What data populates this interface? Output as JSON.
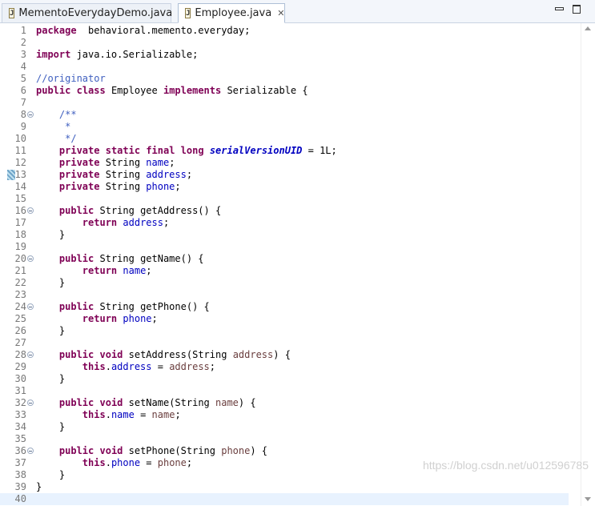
{
  "tabs": [
    {
      "label": "MementoEverydayDemo.java",
      "icon": "java-file-icon",
      "active": false
    },
    {
      "label": "Employee.java",
      "icon": "java-file-icon",
      "active": true,
      "close_glyph": "✕"
    }
  ],
  "window_controls": {
    "minimize": "minimize-icon",
    "maximize": "maximize-icon"
  },
  "editor": {
    "lines": [
      {
        "n": "1",
        "fold": false,
        "parts": [
          [
            "kw",
            "package"
          ],
          [
            "",
            "  behavioral.memento.everyday;"
          ]
        ]
      },
      {
        "n": "2",
        "fold": false,
        "parts": []
      },
      {
        "n": "3",
        "fold": false,
        "parts": [
          [
            "kw",
            "import"
          ],
          [
            "",
            " java.io.Serializable;"
          ]
        ]
      },
      {
        "n": "4",
        "fold": false,
        "parts": []
      },
      {
        "n": "5",
        "fold": false,
        "parts": [
          [
            "cm",
            "//originator"
          ]
        ]
      },
      {
        "n": "6",
        "fold": false,
        "parts": [
          [
            "kw",
            "public"
          ],
          [
            "",
            " "
          ],
          [
            "kw",
            "class"
          ],
          [
            "",
            " Employee "
          ],
          [
            "kw",
            "implements"
          ],
          [
            "",
            " Serializable {"
          ]
        ]
      },
      {
        "n": "7",
        "fold": false,
        "parts": []
      },
      {
        "n": "8",
        "fold": true,
        "parts": [
          [
            "",
            "    "
          ],
          [
            "cm",
            "/**"
          ]
        ]
      },
      {
        "n": "9",
        "fold": false,
        "parts": [
          [
            "",
            "     "
          ],
          [
            "cm",
            "*"
          ]
        ]
      },
      {
        "n": "10",
        "fold": false,
        "parts": [
          [
            "",
            "     "
          ],
          [
            "cm",
            "*/"
          ]
        ]
      },
      {
        "n": "11",
        "fold": false,
        "parts": [
          [
            "",
            "    "
          ],
          [
            "kw",
            "private"
          ],
          [
            "",
            " "
          ],
          [
            "kw",
            "static"
          ],
          [
            "",
            " "
          ],
          [
            "kw",
            "final"
          ],
          [
            "",
            " "
          ],
          [
            "kw",
            "long"
          ],
          [
            "",
            " "
          ],
          [
            "sfld",
            "serialVersionUID"
          ],
          [
            "",
            " = 1L;"
          ]
        ]
      },
      {
        "n": "12",
        "fold": false,
        "parts": [
          [
            "",
            "    "
          ],
          [
            "kw",
            "private"
          ],
          [
            "",
            " String "
          ],
          [
            "fld",
            "name"
          ],
          [
            "",
            ";"
          ]
        ]
      },
      {
        "n": "13",
        "fold": false,
        "marker": true,
        "parts": [
          [
            "",
            "    "
          ],
          [
            "kw",
            "private"
          ],
          [
            "",
            " String "
          ],
          [
            "fld",
            "address"
          ],
          [
            "",
            ";"
          ]
        ]
      },
      {
        "n": "14",
        "fold": false,
        "parts": [
          [
            "",
            "    "
          ],
          [
            "kw",
            "private"
          ],
          [
            "",
            " String "
          ],
          [
            "fld",
            "phone"
          ],
          [
            "",
            ";"
          ]
        ]
      },
      {
        "n": "15",
        "fold": false,
        "parts": []
      },
      {
        "n": "16",
        "fold": true,
        "parts": [
          [
            "",
            "    "
          ],
          [
            "kw",
            "public"
          ],
          [
            "",
            " String getAddress() {"
          ]
        ]
      },
      {
        "n": "17",
        "fold": false,
        "parts": [
          [
            "",
            "        "
          ],
          [
            "kw",
            "return"
          ],
          [
            "",
            " "
          ],
          [
            "fld",
            "address"
          ],
          [
            "",
            ";"
          ]
        ]
      },
      {
        "n": "18",
        "fold": false,
        "parts": [
          [
            "",
            "    }"
          ]
        ]
      },
      {
        "n": "19",
        "fold": false,
        "parts": []
      },
      {
        "n": "20",
        "fold": true,
        "parts": [
          [
            "",
            "    "
          ],
          [
            "kw",
            "public"
          ],
          [
            "",
            " String getName() {"
          ]
        ]
      },
      {
        "n": "21",
        "fold": false,
        "parts": [
          [
            "",
            "        "
          ],
          [
            "kw",
            "return"
          ],
          [
            "",
            " "
          ],
          [
            "fld",
            "name"
          ],
          [
            "",
            ";"
          ]
        ]
      },
      {
        "n": "22",
        "fold": false,
        "parts": [
          [
            "",
            "    }"
          ]
        ]
      },
      {
        "n": "23",
        "fold": false,
        "parts": []
      },
      {
        "n": "24",
        "fold": true,
        "parts": [
          [
            "",
            "    "
          ],
          [
            "kw",
            "public"
          ],
          [
            "",
            " String getPhone() {"
          ]
        ]
      },
      {
        "n": "25",
        "fold": false,
        "parts": [
          [
            "",
            "        "
          ],
          [
            "kw",
            "return"
          ],
          [
            "",
            " "
          ],
          [
            "fld",
            "phone"
          ],
          [
            "",
            ";"
          ]
        ]
      },
      {
        "n": "26",
        "fold": false,
        "parts": [
          [
            "",
            "    }"
          ]
        ]
      },
      {
        "n": "27",
        "fold": false,
        "parts": []
      },
      {
        "n": "28",
        "fold": true,
        "parts": [
          [
            "",
            "    "
          ],
          [
            "kw",
            "public"
          ],
          [
            "",
            " "
          ],
          [
            "kw",
            "void"
          ],
          [
            "",
            " setAddress(String "
          ],
          [
            "prm",
            "address"
          ],
          [
            "",
            ") {"
          ]
        ]
      },
      {
        "n": "29",
        "fold": false,
        "parts": [
          [
            "",
            "        "
          ],
          [
            "kw",
            "this"
          ],
          [
            "",
            "."
          ],
          [
            "fld",
            "address"
          ],
          [
            "",
            " = "
          ],
          [
            "prm",
            "address"
          ],
          [
            "",
            ";"
          ]
        ]
      },
      {
        "n": "30",
        "fold": false,
        "parts": [
          [
            "",
            "    }"
          ]
        ]
      },
      {
        "n": "31",
        "fold": false,
        "parts": []
      },
      {
        "n": "32",
        "fold": true,
        "parts": [
          [
            "",
            "    "
          ],
          [
            "kw",
            "public"
          ],
          [
            "",
            " "
          ],
          [
            "kw",
            "void"
          ],
          [
            "",
            " setName(String "
          ],
          [
            "prm",
            "name"
          ],
          [
            "",
            ") {"
          ]
        ]
      },
      {
        "n": "33",
        "fold": false,
        "parts": [
          [
            "",
            "        "
          ],
          [
            "kw",
            "this"
          ],
          [
            "",
            "."
          ],
          [
            "fld",
            "name"
          ],
          [
            "",
            " = "
          ],
          [
            "prm",
            "name"
          ],
          [
            "",
            ";"
          ]
        ]
      },
      {
        "n": "34",
        "fold": false,
        "parts": [
          [
            "",
            "    }"
          ]
        ]
      },
      {
        "n": "35",
        "fold": false,
        "parts": []
      },
      {
        "n": "36",
        "fold": true,
        "parts": [
          [
            "",
            "    "
          ],
          [
            "kw",
            "public"
          ],
          [
            "",
            " "
          ],
          [
            "kw",
            "void"
          ],
          [
            "",
            " setPhone(String "
          ],
          [
            "prm",
            "phone"
          ],
          [
            "",
            ") {"
          ]
        ]
      },
      {
        "n": "37",
        "fold": false,
        "parts": [
          [
            "",
            "        "
          ],
          [
            "kw",
            "this"
          ],
          [
            "",
            "."
          ],
          [
            "fld",
            "phone"
          ],
          [
            "",
            " = "
          ],
          [
            "prm",
            "phone"
          ],
          [
            "",
            ";"
          ]
        ]
      },
      {
        "n": "38",
        "fold": false,
        "parts": [
          [
            "",
            "    }"
          ]
        ]
      },
      {
        "n": "39",
        "fold": false,
        "parts": [
          [
            "",
            "}"
          ]
        ]
      },
      {
        "n": "40",
        "fold": false,
        "current": true,
        "parts": []
      }
    ]
  },
  "watermark": "https://blog.csdn.net/u012596785"
}
